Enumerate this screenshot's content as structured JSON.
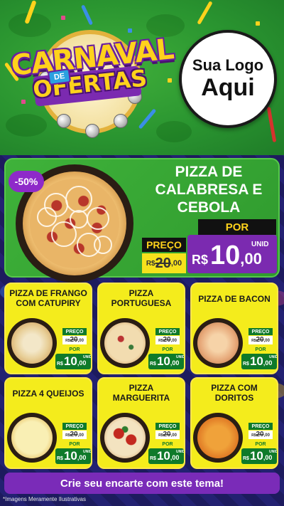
{
  "header": {
    "title_line1": "CARNAVAL",
    "title_de": "DE",
    "title_line2": "OFERTAS",
    "logo_line1": "Sua Logo",
    "logo_line2": "Aqui"
  },
  "featured": {
    "discount": "-50%",
    "name": "PIZZA DE CALABRESA E CEBOLA",
    "preco_label": "PREÇO",
    "old_price": {
      "currency": "R$",
      "int": "20",
      "dec": ",00"
    },
    "por_label": "POR",
    "unit": "UNID",
    "new_price": {
      "currency": "R$",
      "int": "10",
      "dec": ",00"
    }
  },
  "products": [
    {
      "name": "PIZZA DE FRANGO COM CATUPIRY",
      "preco_label": "PREÇO",
      "old_price": {
        "currency": "R$",
        "int": "20",
        "dec": ",00"
      },
      "por_label": "POR",
      "unit": "UNID",
      "new_price": {
        "currency": "R$",
        "int": "10",
        "dec": ",00"
      }
    },
    {
      "name": "PIZZA PORTUGUESA",
      "preco_label": "PREÇO",
      "old_price": {
        "currency": "R$",
        "int": "20",
        "dec": ",00"
      },
      "por_label": "POR",
      "unit": "UNID",
      "new_price": {
        "currency": "R$",
        "int": "10",
        "dec": ",00"
      }
    },
    {
      "name": "PIZZA DE BACON",
      "preco_label": "PREÇO",
      "old_price": {
        "currency": "R$",
        "int": "20",
        "dec": ",00"
      },
      "por_label": "POR",
      "unit": "UNID",
      "new_price": {
        "currency": "R$",
        "int": "10",
        "dec": ",00"
      }
    },
    {
      "name": "PIZZA 4 QUEIJOS",
      "preco_label": "PREÇO",
      "old_price": {
        "currency": "R$",
        "int": "20",
        "dec": ",00"
      },
      "por_label": "POR",
      "unit": "UNID",
      "new_price": {
        "currency": "R$",
        "int": "10",
        "dec": ",00"
      }
    },
    {
      "name": "PIZZA MARGUERITA",
      "preco_label": "PREÇO",
      "old_price": {
        "currency": "R$",
        "int": "20",
        "dec": ",00"
      },
      "por_label": "POR",
      "unit": "UNID",
      "new_price": {
        "currency": "R$",
        "int": "10",
        "dec": ",00"
      }
    },
    {
      "name": "PIZZA COM DORITOS",
      "preco_label": "PREÇO",
      "old_price": {
        "currency": "R$",
        "int": "20",
        "dec": ",00"
      },
      "por_label": "POR",
      "unit": "UNID",
      "new_price": {
        "currency": "R$",
        "int": "10",
        "dec": ",00"
      }
    }
  ],
  "cta": {
    "label": "Crie seu encarte com este tema!"
  },
  "footnote": "*Imagens Meramente Ilustrativas",
  "colors": {
    "header_green": "#2a9530",
    "featured_green": "#3fb23a",
    "card_yellow": "#f4ec1c",
    "price_green": "#0f7a2a",
    "accent_purple": "#7b2ab0",
    "title_yellow": "#ffd21c",
    "background_navy": "#1d1b5e"
  },
  "icons": [
    "tambourine-icon",
    "carnival-mask-icon",
    "streamer-icon",
    "confetti-icon"
  ]
}
